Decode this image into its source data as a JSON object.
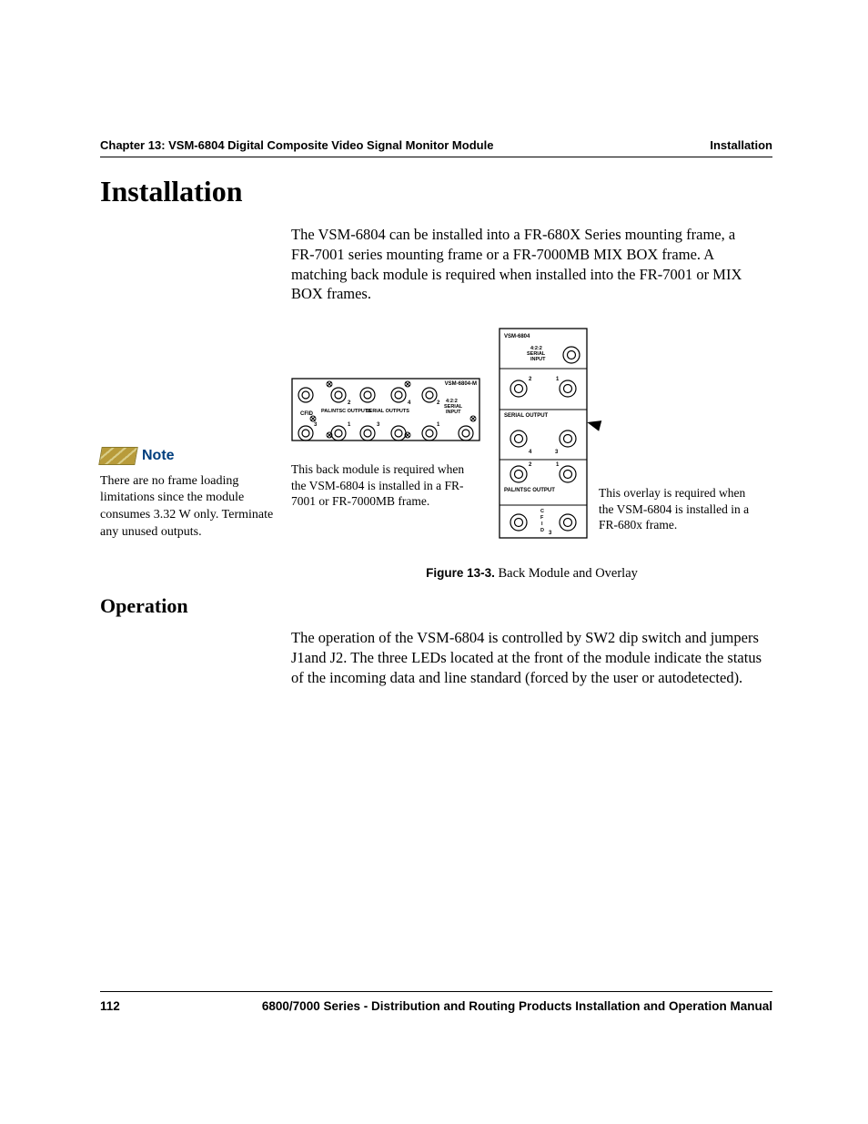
{
  "header": {
    "chapter": "Chapter 13: VSM-6804 Digital Composite Video Signal Monitor Module",
    "section": "Installation"
  },
  "headings": {
    "installation": "Installation",
    "operation": "Operation"
  },
  "paragraphs": {
    "intro": "The VSM-6804 can be installed into a FR-680X Series mounting frame, a FR-7001 series mounting frame or a FR-7000MB MIX BOX frame. A matching back module is required when installed into the FR-7001 or MIX BOX frames.",
    "operation": "The operation of the VSM-6804 is controlled by SW2 dip switch and jumpers J1and J2. The three LEDs located at the front of the module indicate the status of the incoming data and line standard (forced by the user or autodetected)."
  },
  "note": {
    "label": "Note",
    "body": "There are no frame loading limitations since the module consumes 3.32 W only. Terminate any unused outputs."
  },
  "figure": {
    "back_module_caption": "This back module is required when the VSM-6804 is installed in a FR-7001 or FR-7000MB frame.",
    "overlay_caption": "This overlay is required when the VSM-6804 is installed in a FR-680x frame.",
    "caption_label": "Figure 13-3.",
    "caption_text": " Back Module and Overlay",
    "back_module": {
      "title": "VSM-6804-M",
      "labels": {
        "cfid": "CFID",
        "pal": "PAL/NTSC OUTPUTS",
        "serial_out": "SERIAL OUTPUTS",
        "serial_in_1": "4:2:2",
        "serial_in_2": "SERIAL",
        "serial_in_3": "INPUT"
      },
      "numbers": {
        "n1": "1",
        "n2": "2",
        "n3": "3",
        "n4": "4"
      }
    },
    "overlay": {
      "title": "VSM-6804",
      "labels": {
        "serial_in_1": "4:2:2",
        "serial_in_2": "SERIAL",
        "serial_in_3": "INPUT",
        "serial_out": "SERIAL OUTPUT",
        "pal": "PAL/NTSC OUTPUT",
        "cfid_c": "C",
        "cfid_f": "F",
        "cfid_i": "I",
        "cfid_d": "D"
      },
      "numbers": {
        "n1": "1",
        "n2": "2",
        "n3": "3",
        "n4": "4"
      }
    }
  },
  "footer": {
    "page": "112",
    "manual": "6800/7000 Series - Distribution and Routing Products Installation and Operation Manual"
  }
}
